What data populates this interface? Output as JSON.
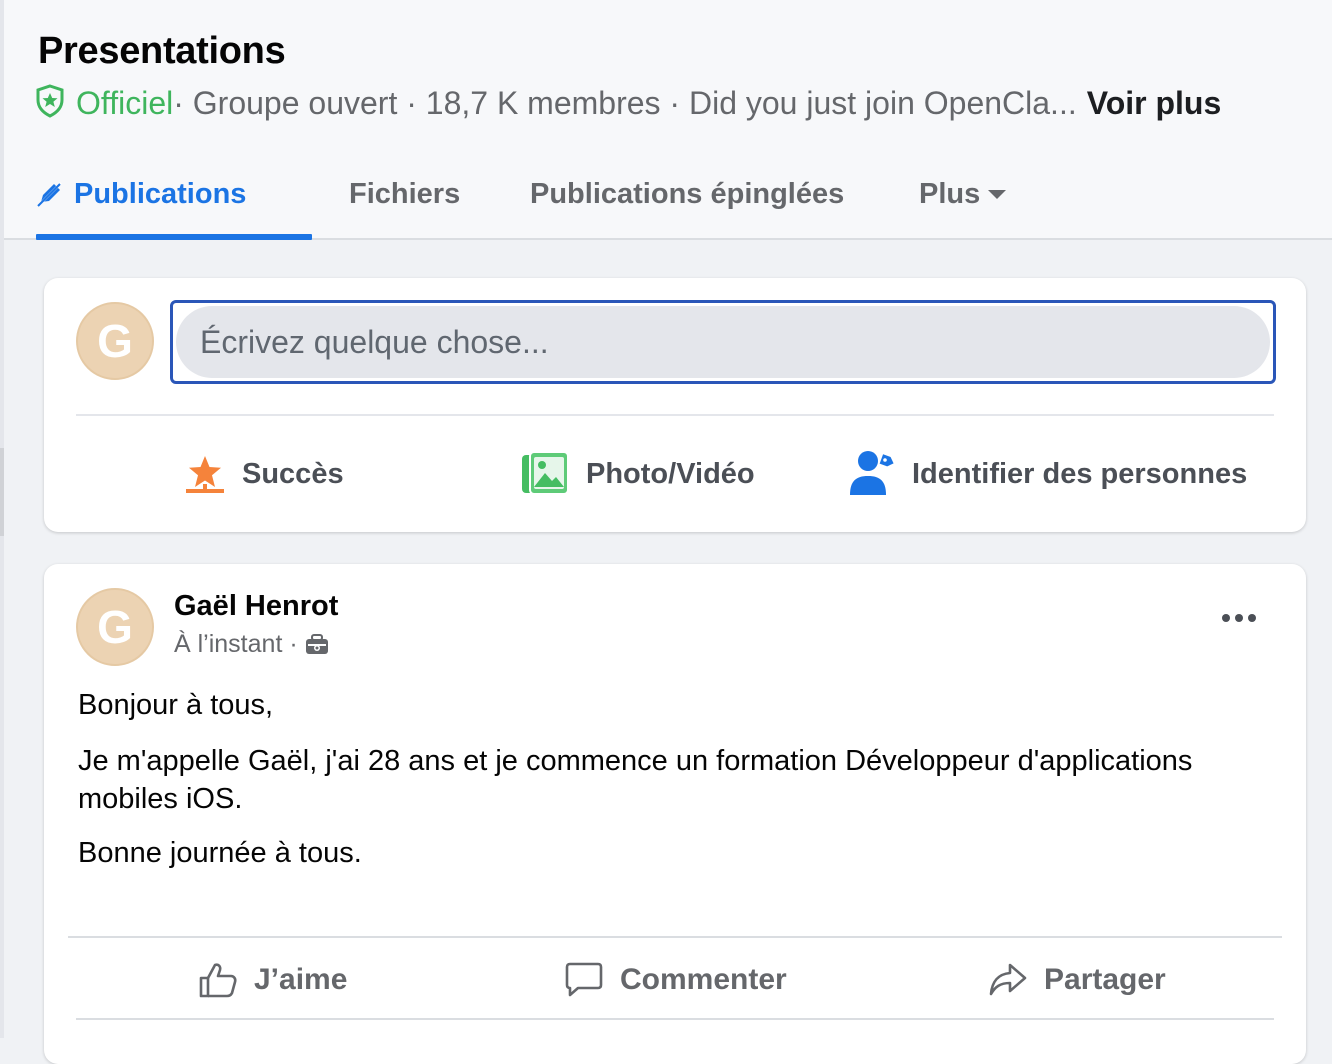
{
  "group": {
    "title": "Presentations",
    "badge_icon": "shield-star-icon",
    "official_label": "Officiel",
    "meta_text": " · Groupe ouvert · 18,7 K membres · Did you just join OpenCla...",
    "see_more": "Voir plus"
  },
  "tabs": [
    {
      "label": "Publications",
      "icon": "pen-icon",
      "active": true
    },
    {
      "label": "Fichiers"
    },
    {
      "label": "Publications épinglées"
    },
    {
      "label": "Plus",
      "icon": "caret-down-icon"
    }
  ],
  "composer": {
    "avatar_letter": "G",
    "placeholder": "Écrivez quelque chose...",
    "actions": [
      {
        "label": "Succès",
        "icon": "star-icon"
      },
      {
        "label": "Photo/Vidéo",
        "icon": "photo-icon"
      },
      {
        "label": "Identifier des personnes",
        "icon": "tag-people-icon"
      }
    ]
  },
  "post": {
    "avatar_letter": "G",
    "author": "Gaël Henrot",
    "time": "À l’instant ·",
    "privacy_icon": "group-privacy-icon",
    "body": [
      "Bonjour à tous,",
      "Je m'appelle Gaël, j'ai 28 ans et je commence un formation Développeur d'applications mobiles iOS.",
      "Bonne journée à tous."
    ],
    "actions": [
      {
        "label": "J’aime",
        "icon": "like-icon"
      },
      {
        "label": "Commenter",
        "icon": "comment-icon"
      },
      {
        "label": "Partager",
        "icon": "share-icon"
      }
    ]
  },
  "colors": {
    "accent": "#1b74e4",
    "official": "#3fb55d",
    "background": "#f0f2f5"
  }
}
